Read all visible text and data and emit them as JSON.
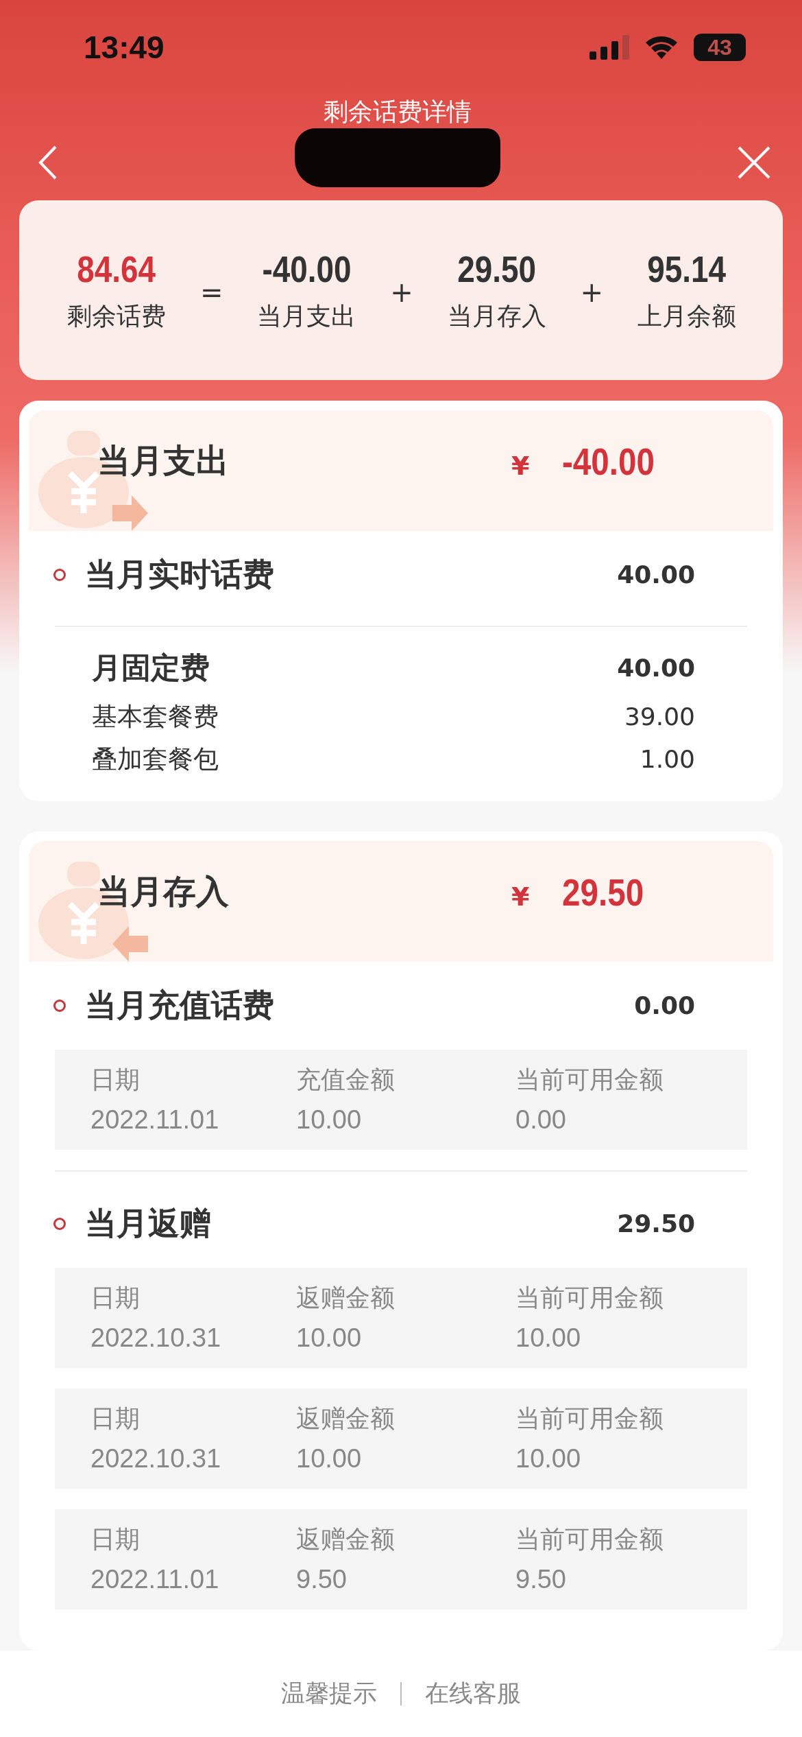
{
  "status_bar": {
    "time": "13:49",
    "battery": "43"
  },
  "header": {
    "title": "剩余话费详情"
  },
  "summary": {
    "terms": [
      {
        "value": "84.64",
        "label": "剩余话费",
        "emphasis": true
      },
      {
        "value": "-40.00",
        "label": "当月支出",
        "emphasis": false
      },
      {
        "value": "29.50",
        "label": "当月存入",
        "emphasis": false
      },
      {
        "value": "95.14",
        "label": "上月余额",
        "emphasis": false
      }
    ],
    "operators": [
      "=",
      "+",
      "+"
    ]
  },
  "sections": [
    {
      "title": "当月支出",
      "kind": "expense",
      "currency": "¥",
      "amount": "-40.00",
      "groups": [
        {
          "kind": "subtotal",
          "label": "当月实时话费",
          "value": "40.00"
        },
        {
          "kind": "fees",
          "heading": "月固定费",
          "value": "40.00",
          "items": [
            {
              "label": "基本套餐费",
              "value": "39.00"
            },
            {
              "label": "叠加套餐包",
              "value": "1.00"
            }
          ]
        }
      ]
    },
    {
      "title": "当月存入",
      "kind": "deposit",
      "currency": "¥",
      "amount": "29.50",
      "groups": [
        {
          "kind": "subtotal",
          "label": "当月充值话费",
          "value": "0.00",
          "records": [
            [
              {
                "label": "日期",
                "value": "2022.11.01"
              },
              {
                "label": "充值金额",
                "value": "10.00"
              },
              {
                "label": "当前可用金额",
                "value": "0.00"
              }
            ]
          ]
        },
        {
          "kind": "subtotal",
          "label": "当月返赠",
          "value": "29.50",
          "records": [
            [
              {
                "label": "日期",
                "value": "2022.10.31"
              },
              {
                "label": "返赠金额",
                "value": "10.00"
              },
              {
                "label": "当前可用金额",
                "value": "10.00"
              }
            ],
            [
              {
                "label": "日期",
                "value": "2022.10.31"
              },
              {
                "label": "返赠金额",
                "value": "10.00"
              },
              {
                "label": "当前可用金额",
                "value": "10.00"
              }
            ],
            [
              {
                "label": "日期",
                "value": "2022.11.01"
              },
              {
                "label": "返赠金额",
                "value": "9.50"
              },
              {
                "label": "当前可用金额",
                "value": "9.50"
              }
            ]
          ]
        }
      ]
    }
  ],
  "footer": {
    "links": [
      "温馨提示",
      "在线客服"
    ]
  }
}
